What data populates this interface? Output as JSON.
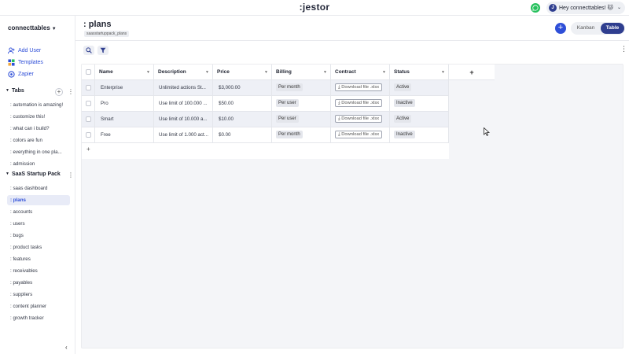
{
  "app": {
    "logo": ":jestor"
  },
  "user": {
    "avatar_letter": "J",
    "greeting": "Hey connecttables! 🐱",
    "chevron": "⌄"
  },
  "sidebar": {
    "workspace": "connecttables",
    "links": [
      {
        "label": "Add User",
        "icon": "add-user-icon"
      },
      {
        "label": "Templates",
        "icon": "templates-icon"
      },
      {
        "label": "Zapier",
        "icon": "zapier-icon"
      }
    ],
    "tabs_section": {
      "title": "Tabs",
      "items": [
        ": automation is amazing!",
        ": customize this!",
        ": what can i build?",
        ": colors are fun",
        ": everything in one pla...",
        ": admission"
      ]
    },
    "pack_section": {
      "title": "SaaS Startup Pack",
      "items": [
        ": saas dashboard",
        ": plans",
        ": accounts",
        ": users",
        ": bugs",
        ": product tasks",
        ": features",
        ": receivables",
        ": payables",
        ": suppliers",
        ": content planner",
        ": growth tracker"
      ],
      "active": ": plans"
    },
    "collapse": "‹"
  },
  "header": {
    "title": ": plans",
    "breadcrumb": "saasstartuppack_plans",
    "add": "+",
    "views": {
      "kanban": "Kanban",
      "table": "Table",
      "selected": "Table"
    }
  },
  "toolbar": {
    "more": "⋮"
  },
  "table": {
    "columns": [
      "Name",
      "Description",
      "Price",
      "Billing",
      "Contract",
      "Status"
    ],
    "add_column": "+",
    "add_row": "+",
    "rows": [
      {
        "name": "Enterprise",
        "description": "Unlimited actions St...",
        "price": "$3,000.00",
        "billing": "Per month",
        "contract": "Download file .xlsx",
        "status": "Active"
      },
      {
        "name": "Pro",
        "description": "Use limit of 100.000 ...",
        "price": "$50.00",
        "billing": "Per user",
        "contract": "Download file .xlsx",
        "status": "Inactive"
      },
      {
        "name": "Smart",
        "description": "Use limit of 10.000 a...",
        "price": "$10.00",
        "billing": "Per user",
        "contract": "Download file .xlsx",
        "status": "Active"
      },
      {
        "name": "Free",
        "description": "Use limit of 1.000 act...",
        "price": "$0.00",
        "billing": "Per month",
        "contract": "Download file .xlsx",
        "status": "Inactive"
      }
    ]
  },
  "colors": {
    "accent": "#2f4fd8",
    "navy": "#2f3e8f",
    "whatsapp": "#25c05c",
    "row_alt": "#eef0f6"
  }
}
